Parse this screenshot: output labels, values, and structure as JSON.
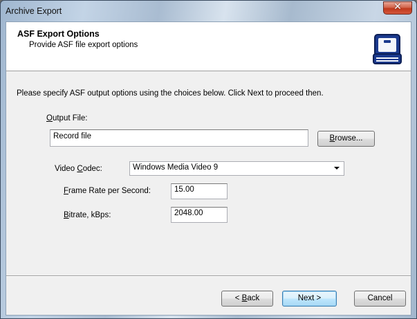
{
  "window": {
    "title": "Archive Export",
    "close_glyph": "✕"
  },
  "header": {
    "title": "ASF Export Options",
    "subtitle": "Provide ASF file export options",
    "icon": "briefcase-icon"
  },
  "instructions": "Please specify ASF output options using the choices below. Click Next to proceed then.",
  "output_file": {
    "label_mnemonic": "O",
    "label_rest": "utput File:",
    "value": "Record file",
    "browse_mnemonic": "B",
    "browse_rest": "rowse..."
  },
  "video_codec": {
    "label_pre": "Video ",
    "label_mnemonic": "C",
    "label_rest": "odec:",
    "value": "Windows Media Video 9"
  },
  "frame_rate": {
    "label_mnemonic": "F",
    "label_rest": "rame Rate per Second:",
    "value": "15.00"
  },
  "bitrate": {
    "label_mnemonic": "B",
    "label_rest": "itrate, kBps:",
    "value": "2048.00"
  },
  "footer": {
    "back_pre": "< ",
    "back_mnemonic": "B",
    "back_rest": "ack",
    "next": "Next >",
    "cancel": "Cancel"
  }
}
